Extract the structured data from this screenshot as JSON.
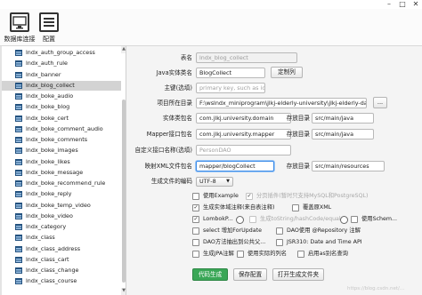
{
  "window": {
    "minimize": "–",
    "maximize": "□",
    "close": "✕"
  },
  "toolbar": {
    "db_connect_label": "数据库连接",
    "config_label": "配置",
    "db_icon": "monitor-icon",
    "config_icon": "list-icon"
  },
  "sidebar": {
    "items": [
      "lndx_auth_group_access",
      "lndx_auth_rule",
      "lndx_banner",
      "lndx_blog_collect",
      "lndx_boke_audio",
      "lndx_boke_blog",
      "lndx_boke_cert",
      "lndx_boke_comment_audio",
      "lndx_boke_comments",
      "lndx_boke_images",
      "lndx_boke_likes",
      "lndx_boke_message",
      "lndx_boke_recommend_rule",
      "lndx_boke_reply",
      "lndx_boke_temp_video",
      "lndx_boke_video",
      "lndx_category",
      "lndx_class",
      "lndx_class_address",
      "lndx_class_cart",
      "lndx_class_change",
      "lndx_class_course"
    ],
    "selected_index": 3
  },
  "form": {
    "table_name": {
      "label": "表名",
      "value": "lndx_blog_collect"
    },
    "java_entity": {
      "label": "Java实体类名",
      "value": "BlogCollect",
      "button": "定制列"
    },
    "primary_key": {
      "label": "主键(选填)",
      "placeholder": "primary key, such as id"
    },
    "project_dir": {
      "label": "项目所在目录",
      "value": "F:\\wslndx_miniprogram\\jlkj-elderly-university\\jlkj-elderly-dao",
      "button": "..."
    },
    "entity_package": {
      "label": "实体类包名",
      "value": "com.jlkj.university.domain",
      "dir_label": "存放目录",
      "dir_value": "src/main/java"
    },
    "mapper_package": {
      "label": "Mapper接口包名",
      "value": "com.jlkj.university.mapper",
      "dir_label": "存放目录",
      "dir_value": "src/main/java"
    },
    "custom_interface": {
      "label": "自定义接口名称(选填)",
      "placeholder": "PersonDAO"
    },
    "xml_package": {
      "label": "映射XML文件包名",
      "value": "mapper/blogCollect",
      "dir_label": "存放目录",
      "dir_value": "src/main/resources"
    },
    "encoding": {
      "label": "生成文件的编码",
      "value": "UTF-8"
    }
  },
  "options": {
    "use_example": "使用Example",
    "paging": "分页插件(暂时只支持MySQL和PostgreSQL)",
    "gen_comment": "生成实体域注释(来自表注释)",
    "overwrite_xml": "覆盖原XML",
    "lombok": "LombokP...",
    "to_string": "生成toString/hashCode/equal...",
    "use_schema": "使用Schem...",
    "select_for_update": "select 增加ForUpdate",
    "dao_repository": "DAO使用 @Repository 注解",
    "dao_public": "DAO方法抽出到公共父...",
    "jsr310": "JSR310: Date and Time API",
    "jpa": "生成JPA注解",
    "actual_column": "使用实际的列名",
    "enable_as_alias": "启用as别名查询"
  },
  "actions": {
    "generate": "代码生成",
    "save_config": "保存配置",
    "open_folder": "打开生成文件夹"
  },
  "watermark": "https://blog.csdn.net/...",
  "colors": {
    "primary": "#3aa757",
    "focus": "#3b8be8",
    "selection": "#d3d3d3"
  }
}
